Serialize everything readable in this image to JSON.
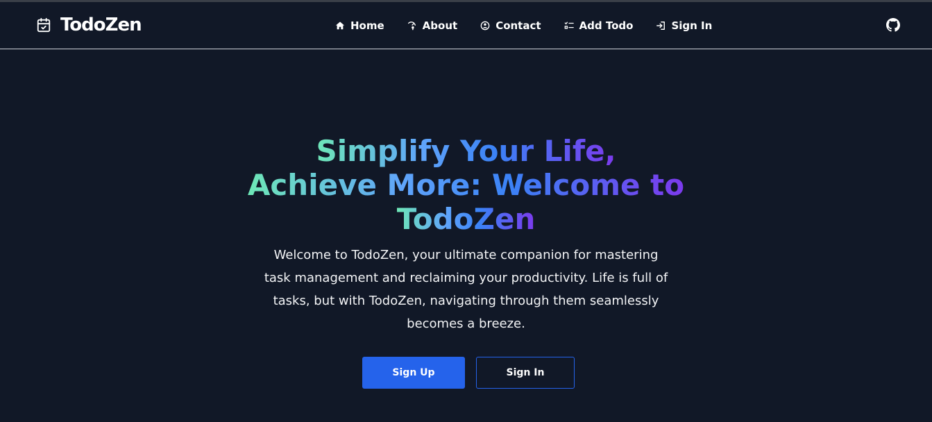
{
  "brand": {
    "name": "TodoZen",
    "icon": "calendar-check-icon"
  },
  "nav": {
    "items": [
      {
        "label": "Home",
        "icon": "home-icon"
      },
      {
        "label": "About",
        "icon": "about-icon"
      },
      {
        "label": "Contact",
        "icon": "contact-icon"
      },
      {
        "label": "Add Todo",
        "icon": "list-check-icon"
      },
      {
        "label": "Sign In",
        "icon": "sign-in-icon"
      }
    ],
    "github_icon": "github-icon"
  },
  "hero": {
    "title_line1": "Simplify Your Life,",
    "title_line2": "Achieve More: Welcome to",
    "title_line3": "TodoZen",
    "description_line1": "Welcome to TodoZen, your ultimate companion for mastering",
    "description_line2": "task management and reclaiming your productivity. Life is full of",
    "description_line3": "tasks, but with TodoZen, navigating through them seamlessly",
    "description_line4": "becomes a breeze.",
    "signup_label": "Sign Up",
    "signin_label": "Sign In"
  },
  "colors": {
    "background": "#111827",
    "primary": "#2563eb",
    "gradient_start": "#6ee7b7",
    "gradient_mid": "#3b82f6",
    "gradient_end": "#7c3aed"
  }
}
